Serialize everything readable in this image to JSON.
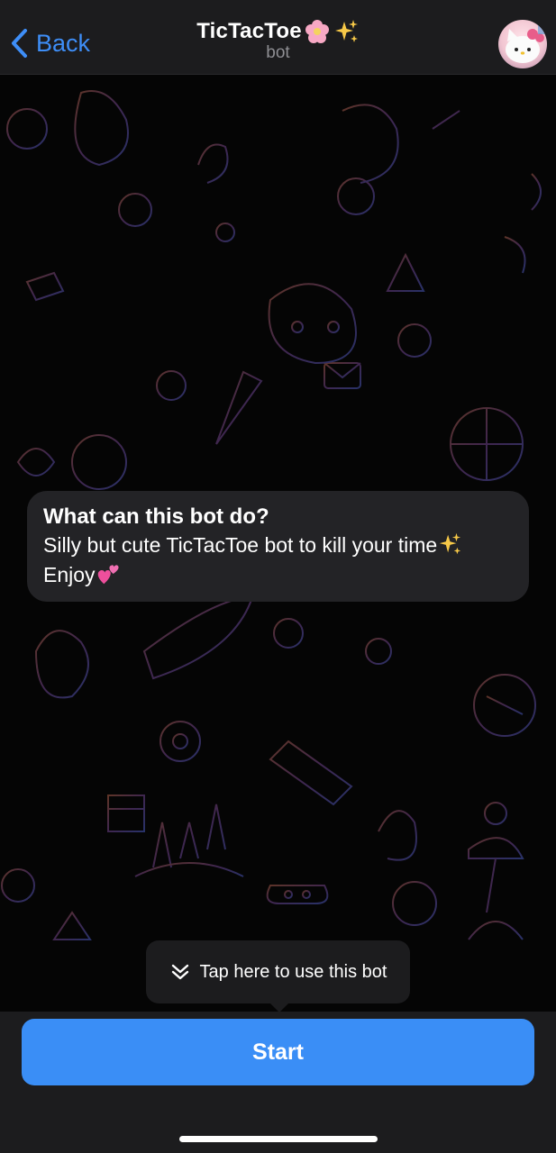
{
  "header": {
    "back_label": "Back",
    "title": "TicTacToe",
    "title_emojis": [
      "cherry-blossom",
      "sparkles"
    ],
    "subtitle": "bot"
  },
  "message": {
    "title": "What can this bot do?",
    "line1": "Silly but cute TicTacToe bot to kill your time",
    "line2": "Enjoy",
    "emojis": [
      "sparkles",
      "two-hearts"
    ]
  },
  "tooltip": {
    "text": "Tap here to use this bot",
    "icon": "double-chevron-down-icon"
  },
  "footer": {
    "start_label": "Start"
  },
  "colors": {
    "accent": "#3a8ef6",
    "link": "#3e8ef7",
    "bubble": "#232326",
    "bar": "#1c1c1e"
  }
}
